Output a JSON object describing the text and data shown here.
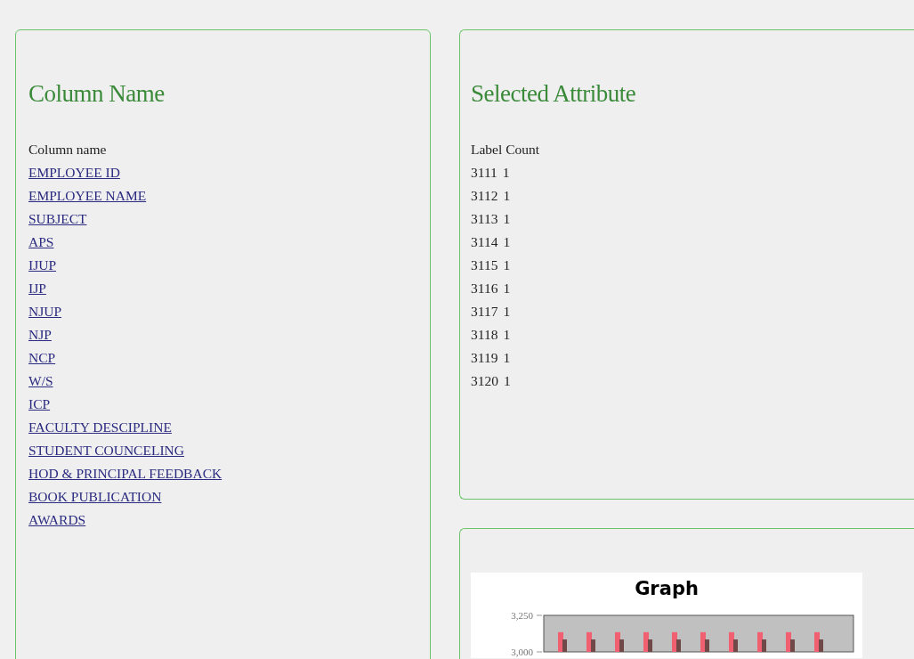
{
  "column_panel": {
    "title": "Column Name",
    "header": "Column name",
    "links": [
      "EMPLOYEE ID",
      "EMPLOYEE NAME",
      "SUBJECT",
      "APS",
      "IJUP",
      "IJP",
      "NJUP",
      "NJP",
      "NCP",
      "W/S",
      "ICP",
      "FACULTY DESCIPLINE",
      "STUDENT COUNCELING",
      "HOD & PRINCIPAL FEEDBACK",
      "BOOK PUBLICATION",
      "AWARDS"
    ]
  },
  "attribute_panel": {
    "title": "Selected Attribute",
    "header": "Label Count",
    "rows": [
      {
        "label": "3111",
        "count": "1"
      },
      {
        "label": "3112",
        "count": "1"
      },
      {
        "label": "3113",
        "count": "1"
      },
      {
        "label": "3114",
        "count": "1"
      },
      {
        "label": "3115",
        "count": "1"
      },
      {
        "label": "3116",
        "count": "1"
      },
      {
        "label": "3117",
        "count": "1"
      },
      {
        "label": "3118",
        "count": "1"
      },
      {
        "label": "3119",
        "count": "1"
      },
      {
        "label": "3120",
        "count": "1"
      }
    ]
  },
  "graph_panel": {
    "chart_data": {
      "type": "bar",
      "title": "Graph",
      "ylim": [
        3000,
        3250
      ],
      "yticks": [
        {
          "value": 3000,
          "label": "3,000"
        },
        {
          "value": 3250,
          "label": "3,250"
        }
      ],
      "series": [
        {
          "color": "#f06070",
          "values": [
            3135,
            3135,
            3135,
            3135,
            3135,
            3135,
            3135,
            3135,
            3135,
            3135
          ]
        },
        {
          "color": "#704848",
          "values": [
            3085,
            3085,
            3085,
            3085,
            3085,
            3085,
            3085,
            3085,
            3085,
            3085
          ]
        }
      ]
    }
  }
}
